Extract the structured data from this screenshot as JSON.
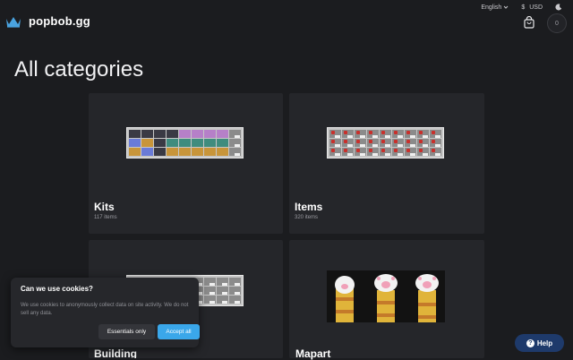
{
  "brand": {
    "name": "popbob.gg",
    "accent": "#4aa3df"
  },
  "topbar": {
    "language": "English",
    "currency_symbol": "$",
    "currency": "USD",
    "cart_count": "0"
  },
  "page": {
    "title": "All categories"
  },
  "categories": [
    {
      "name": "Kits",
      "count": "117 items"
    },
    {
      "name": "Items",
      "count": "320 items"
    },
    {
      "name": "Building",
      "count": ""
    },
    {
      "name": "Mapart",
      "count": ""
    }
  ],
  "cookie_banner": {
    "title": "Can we use cookies?",
    "text": "We use cookies to anonymously collect data on site activity. We do not sell any data.",
    "essentials_label": "Essentials only",
    "accept_label": "Accept all",
    "accept_color": "#3aa7ea"
  },
  "help": {
    "label": "Help"
  }
}
